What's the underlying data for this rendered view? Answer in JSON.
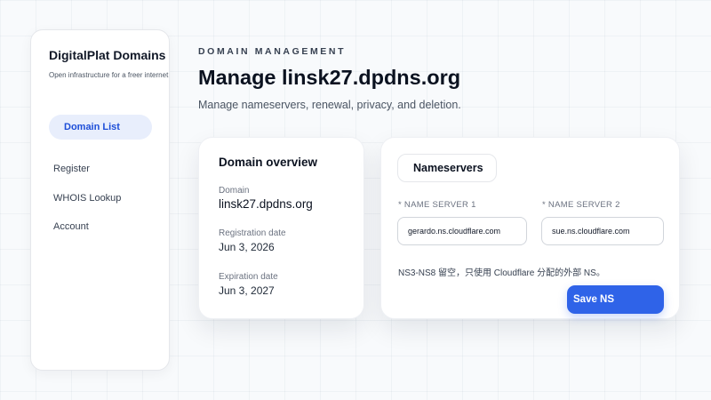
{
  "sidebar": {
    "brand_title": "DigitalPlat Domains",
    "brand_subtitle": "Open infrastructure for a freer internet",
    "items": [
      {
        "label": "Domain List",
        "active": true
      },
      {
        "label": "Register"
      },
      {
        "label": "WHOIS Lookup"
      },
      {
        "label": "Account"
      }
    ]
  },
  "header": {
    "eyebrow": "DOMAIN MANAGEMENT",
    "title": "Manage linsk27.dpdns.org",
    "subtitle": "Manage nameservers, renewal, privacy, and deletion."
  },
  "overview": {
    "title": "Domain overview",
    "domain_label": "Domain",
    "domain_value": "linsk27.dpdns.org",
    "registration_label": "Registration date",
    "registration_value": "Jun 3, 2026",
    "expiration_label": "Expiration date",
    "expiration_value": "Jun 3, 2027"
  },
  "nameservers": {
    "title": "Nameservers",
    "ns1_label": "* NAME SERVER 1",
    "ns1_value": "gerardo.ns.cloudflare.com",
    "ns2_label": "* NAME SERVER 2",
    "ns2_value": "sue.ns.cloudflare.com",
    "note": "NS3-NS8 留空，只使用 Cloudflare 分配的外部 NS。",
    "save_label": "Save NS"
  },
  "colors": {
    "accent": "#2f63e8",
    "active_nav_bg": "#e8eefc",
    "active_nav_text": "#1d4ed8",
    "page_bg": "#f8fafc"
  }
}
